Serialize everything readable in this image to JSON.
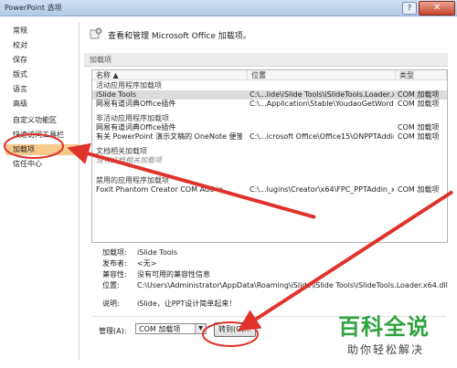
{
  "window": {
    "title": "PowerPoint 选项",
    "help_glyph": "?",
    "close_glyph": "✕"
  },
  "sidebar": {
    "items": [
      {
        "label": "常规"
      },
      {
        "label": "校对"
      },
      {
        "label": "保存"
      },
      {
        "label": "版式"
      },
      {
        "label": "语言"
      },
      {
        "label": "高级"
      },
      {
        "label": "自定义功能区"
      },
      {
        "label": "快速访问工具栏"
      },
      {
        "label": "加载项"
      },
      {
        "label": "信任中心"
      }
    ],
    "selected_index": 8
  },
  "header": {
    "text": "查看和管理 Microsoft Office 加载项。"
  },
  "section": {
    "title": "加载项"
  },
  "grid": {
    "columns": [
      "名称 ▲",
      "位置",
      "类型"
    ],
    "rows": [
      {
        "kind": "group",
        "label": "活动应用程序加载项"
      },
      {
        "kind": "item",
        "name": "iSlide Tools",
        "location": "C:\\...lide\\iSlide Tools\\iSlideTools.Loader.x64.dll",
        "type": "COM 加载项",
        "selected": true
      },
      {
        "kind": "item",
        "name": "网易有道词典Office插件",
        "location": "C:\\...Application\\Stable\\YoudaoGetWord64.dll",
        "type": "COM 加载项"
      },
      {
        "kind": "group",
        "label": "非活动应用程序加载项"
      },
      {
        "kind": "item",
        "name": "网易有道词典Office插件",
        "location": "",
        "type": "COM 加载项"
      },
      {
        "kind": "item",
        "name": "有关 PowerPoint 演示文稿的 OneNote 便笺",
        "location": "C:\\...icrosoft Office\\Office15\\ONPPTAddin.dll",
        "type": "COM 加载项"
      },
      {
        "kind": "group",
        "label": "文档相关加载项"
      },
      {
        "kind": "muted",
        "name": "没有文档相关加载项",
        "location": "",
        "type": ""
      },
      {
        "kind": "group",
        "label": "禁用的应用程序加载项"
      },
      {
        "kind": "item",
        "name": "Foxit Phantom Creator COM Add-in",
        "location": "C:\\...lugins\\Creator\\x64\\FPC_PPTAddin_x64.dll",
        "type": "COM 加载项"
      }
    ]
  },
  "details": {
    "addin_label": "加载项:",
    "addin_value": "iSlide Tools",
    "publisher_label": "发布者:",
    "publisher_value": "<无>",
    "compat_label": "兼容性:",
    "compat_value": "没有可用的兼容性信息",
    "location_label": "位置:",
    "location_value": "C:\\Users\\Administrator\\AppData\\Roaming\\iSlide\\iSlide Tools\\iSlideTools.Loader.x64.dll",
    "desc_label": "说明:",
    "desc_value": "iSlide，让PPT设计简单起来！"
  },
  "manage": {
    "label": "管理(A):",
    "selected": "COM 加载项",
    "go_label": "转到(G)..."
  },
  "watermark": {
    "big": "百科全说",
    "small": "助你轻松解决"
  },
  "colors": {
    "annotation_red": "#e0322b",
    "selected_nav": "#f7c98b",
    "watermark_green": "#2fa33d"
  }
}
